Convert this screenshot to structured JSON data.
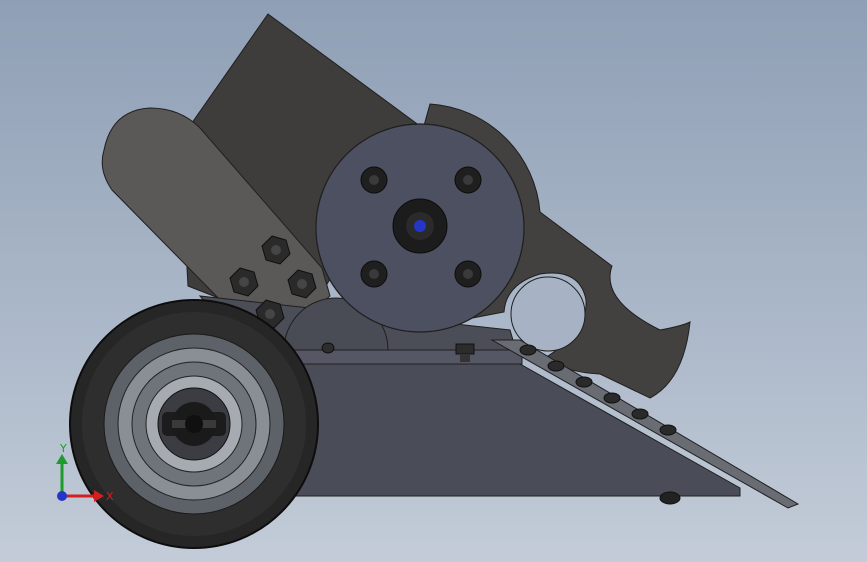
{
  "viewport": {
    "background_top": "#8f9fb5",
    "background_bottom": "#c3ccd8"
  },
  "model": {
    "description_icon": "robot-cad-model-icon",
    "colors": {
      "dark_metal": "#3c3b3a",
      "mid_metal": "#4a4948",
      "light_metal": "#5b5a59",
      "plate": "#4a4e58",
      "tire": "#2b2b2b"
    }
  },
  "triad": {
    "x_label": "X",
    "y_label": "Y",
    "x_color": "#d22020",
    "y_color": "#1f9a2e",
    "z_color": "#2436c8"
  }
}
